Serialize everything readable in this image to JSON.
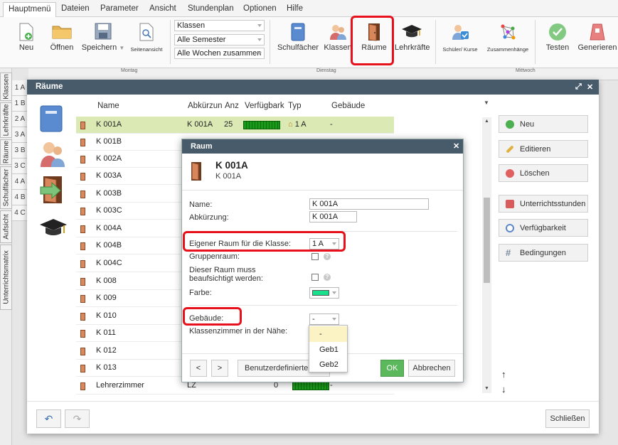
{
  "menubar": {
    "items": [
      "Hauptmenü",
      "Dateien",
      "Parameter",
      "Ansicht",
      "Stundenplan",
      "Optionen",
      "Hilfe"
    ]
  },
  "ribbon": {
    "neu": "Neu",
    "oeffnen": "Öffnen",
    "speichern": "Speichern",
    "seitenansicht": "Seitenansicht",
    "select1": "Klassen",
    "select2": "Alle Semester",
    "select3": "Alle Wochen zusammen",
    "schulfaecher": "Schulfächer",
    "klassen": "Klassen",
    "raeume": "Räume",
    "lehrkraefte": "Lehrkräfte",
    "schueler": "Schüler/ Kurse",
    "zusammenhaenge": "Zusammenhänge",
    "testen": "Testen",
    "generieren": "Generieren"
  },
  "timetable": {
    "days": [
      "Montag",
      "Dienstag",
      "Mittwoch"
    ],
    "rows": [
      "1 A",
      "1 B",
      "2 A",
      "3 A",
      "3 B",
      "3 C",
      "4 A",
      "4 B",
      "4 C"
    ]
  },
  "vtabs": [
    "Klassen",
    "Lehrkräfte",
    "Räume",
    "Schulfächer",
    "Aufsicht",
    "Unterrichtsmatrix"
  ],
  "main": {
    "title": "Räume",
    "cols": {
      "name": "Name",
      "abk": "Abkürzun",
      "anz": "Anz",
      "verf": "Verfügbark",
      "typ": "Typ",
      "geb": "Gebäude"
    },
    "rooms": [
      {
        "name": "K 001A",
        "abk": "K 001A",
        "anz": "25",
        "typ": "1 A",
        "geb": "-"
      },
      {
        "name": "K 001B"
      },
      {
        "name": "K 002A"
      },
      {
        "name": "K 003A"
      },
      {
        "name": "K 003B"
      },
      {
        "name": "K 003C"
      },
      {
        "name": "K 004A"
      },
      {
        "name": "K 004B"
      },
      {
        "name": "K 004C"
      },
      {
        "name": "K 008"
      },
      {
        "name": "K 009"
      },
      {
        "name": "K 010"
      },
      {
        "name": "K 011"
      },
      {
        "name": "K 012"
      },
      {
        "name": "K 013"
      },
      {
        "name": "Lehrerzimmer",
        "abk": "LZ",
        "anz": "0",
        "geb": "-"
      }
    ],
    "side_buttons": [
      "Neu",
      "Editieren",
      "Löschen",
      "Unterrichtsstunden",
      "Verfügbarkeit",
      "Bedingungen"
    ],
    "close": "Schließen"
  },
  "raum": {
    "title": "Raum",
    "header_name": "K 001A",
    "header_sub": "K 001A",
    "name_label": "Name:",
    "name_value": "K 001A",
    "abk_label": "Abkürzung:",
    "abk_value": "K 001A",
    "eigener_label": "Eigener Raum für die Klasse:",
    "eigener_value": "1 A",
    "gruppen_label": "Gruppenraum:",
    "aufsicht_label": "Dieser Raum muss beaufsichtigt werden:",
    "farbe_label": "Farbe:",
    "farbe_color": "#19e08a",
    "gebaeude_label": "Gebäude:",
    "gebaeude_value": "-",
    "naehe_label": "Klassenzimmer in der Nähe:",
    "gebaeude_options": [
      "-",
      "Geb1",
      "Geb2"
    ],
    "prev": "<",
    "next": ">",
    "benutzer": "Benutzerdefinierte F",
    "ok": "OK",
    "abbrechen": "Abbrechen"
  },
  "colors": {
    "accent": "#485b6b",
    "highlight": "#e8101a",
    "ok_green": "#5cb85c",
    "selected_row": "#dbeab5"
  }
}
